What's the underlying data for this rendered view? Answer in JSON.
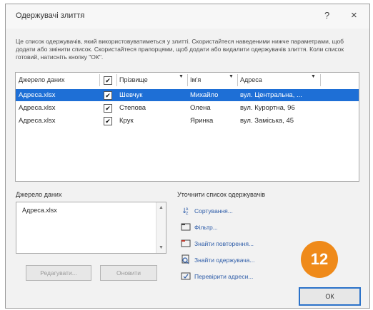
{
  "dialog": {
    "title": "Одержувачі злиття",
    "help": "?",
    "close": "×",
    "intro": "Це список одержувачів, який використовуватиметься у злитті. Скористайтеся наведеними нижче параметрами, щоб додати або змінити список. Скористайтеся прапорцями, щоб додати або видалити одержувачів злиття. Коли список готовий, натисніть кнопку \"ОК\"."
  },
  "grid": {
    "headers": {
      "source": "Джерело даних",
      "surname": "Прізвище",
      "name": "Ім'я",
      "address": "Адреса"
    },
    "rows": [
      {
        "source": "Адреса.xlsx",
        "surname": "Шевчук",
        "name": "Михайло",
        "address": "вул. Центральна, ..."
      },
      {
        "source": "Адреса.xlsx",
        "surname": "Степова",
        "name": "Олена",
        "address": "вул. Курортна, 96"
      },
      {
        "source": "Адреса.xlsx",
        "surname": "Крук",
        "name": "Яринка",
        "address": "вул. Заміська, 45"
      }
    ]
  },
  "source_panel": {
    "label": "Джерело даних",
    "item": "Адреса.xlsx",
    "edit_button": "Редагувати...",
    "refresh_button": "Оновити"
  },
  "refine": {
    "label": "Уточнити список одержувачів",
    "sort": "Сортування...",
    "filter": "Фільтр...",
    "duplicates": "Знайти повторення...",
    "find_recipient": "Знайти одержувача...",
    "validate": "Перевірити адреси..."
  },
  "badge": "12",
  "ok_button": "ОК"
}
